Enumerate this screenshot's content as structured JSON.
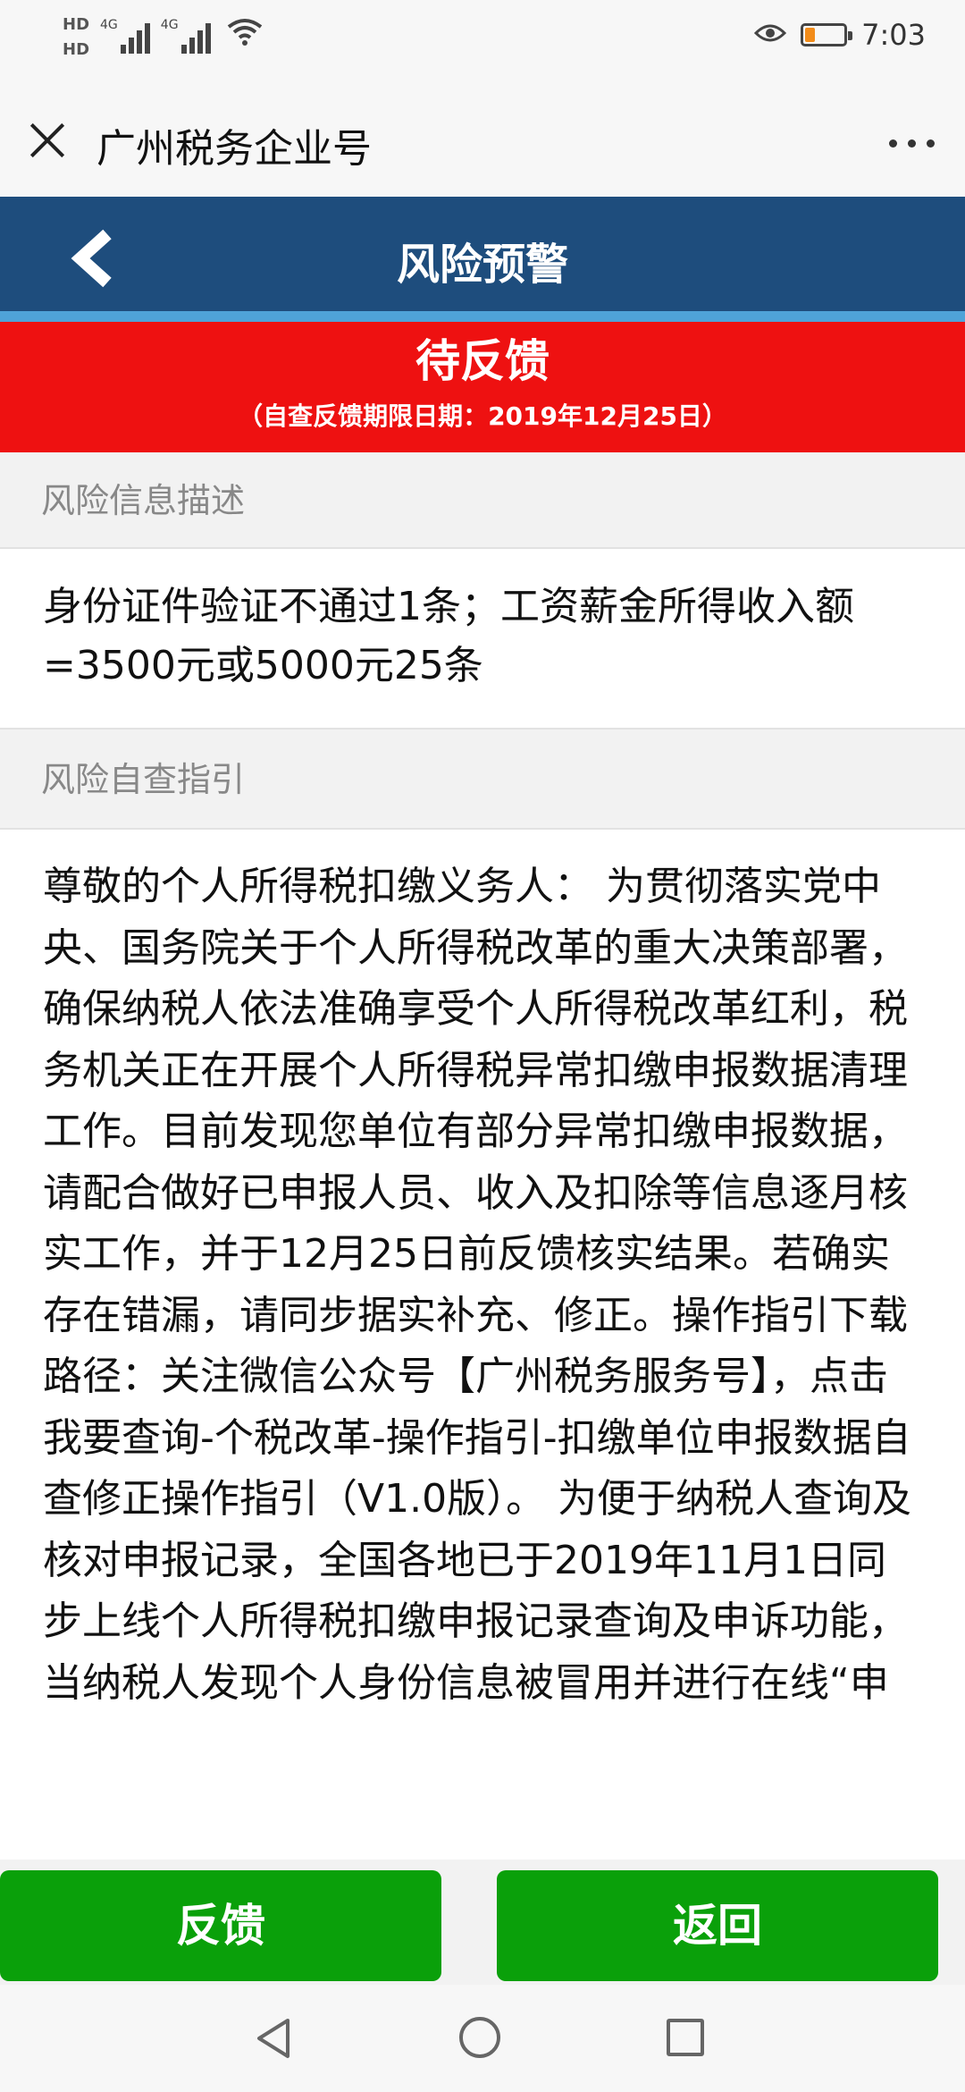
{
  "status_bar": {
    "hd1": "HD",
    "hd2": "HD",
    "signal1": "4G",
    "signal2": "4G",
    "battery_level": 0.25,
    "battery_color": "#f28c1a",
    "time": "7:03"
  },
  "title_bar": {
    "title": "广州税务企业号"
  },
  "header": {
    "title": "风险预警",
    "bg_color": "#1e4d7d"
  },
  "status": {
    "title": "待反馈",
    "deadline": "（自查反馈期限日期：2019年12月25日）",
    "bg_color": "#ee1111"
  },
  "risk_info": {
    "label": "风险信息描述",
    "text": "身份证件验证不通过1条；工资薪金所得收入额=3500元或5000元25条"
  },
  "guide": {
    "label": "风险自查指引",
    "text": "尊敬的个人所得税扣缴义务人： 为贯彻落实党中央、国务院关于个人所得税改革的重大决策部署，确保纳税人依法准确享受个人所得税改革红利，税务机关正在开展个人所得税异常扣缴申报数据清理工作。目前发现您单位有部分异常扣缴申报数据，请配合做好已申报人员、收入及扣除等信息逐月核实工作，并于12月25日前反馈核实结果。若确实存在错漏，请同步据实补充、修正。操作指引下载路径：关注微信公众号【广州税务服务号】，点击我要查询-个税改革-操作指引-扣缴单位申报数据自查修正操作指引（V1.0版）。 为便于纳税人查询及核对申报记录，全国各地已于2019年11月1日同步上线个人所得税扣缴申报记录查询及申诉功能，当纳税人发现个人身份信息被冒用并进行在线“申"
  },
  "buttons": {
    "feedback": "反馈",
    "back": "返回",
    "color": "#0aa00a"
  }
}
